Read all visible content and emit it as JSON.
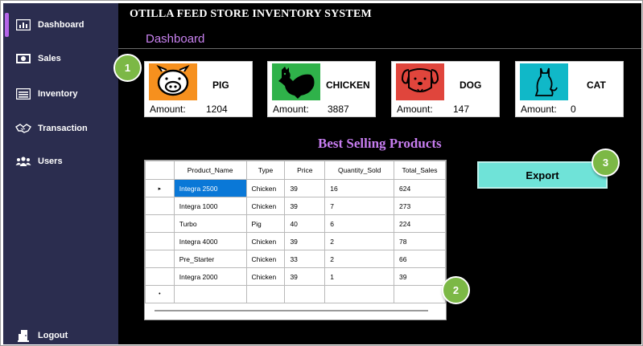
{
  "app_title": "OTILLA FEED STORE INVENTORY SYSTEM",
  "section_title": "Dashboard",
  "sidebar": {
    "items": [
      {
        "label": "Dashboard",
        "icon": "bar-chart-icon",
        "active": true
      },
      {
        "label": "Sales",
        "icon": "money-icon",
        "active": false
      },
      {
        "label": "Inventory",
        "icon": "inventory-box-icon",
        "active": false
      },
      {
        "label": "Transaction",
        "icon": "handshake-icon",
        "active": false
      },
      {
        "label": "Users",
        "icon": "users-icon",
        "active": false
      }
    ],
    "logout": {
      "label": "Logout",
      "icon": "door-icon"
    }
  },
  "cards": [
    {
      "name": "PIG",
      "amount_label": "Amount:",
      "amount": "1204",
      "icon": "pig-icon",
      "color": "#f6901e"
    },
    {
      "name": "CHICKEN",
      "amount_label": "Amount:",
      "amount": "3887",
      "icon": "chicken-icon",
      "color": "#2fb24a"
    },
    {
      "name": "DOG",
      "amount_label": "Amount:",
      "amount": "147",
      "icon": "dog-icon",
      "color": "#e0453c"
    },
    {
      "name": "CAT",
      "amount_label": "Amount:",
      "amount": "0",
      "icon": "cat-icon",
      "color": "#10b8c8"
    }
  ],
  "best_selling_title": "Best Selling Products",
  "table": {
    "columns": [
      "Product_Name",
      "Type",
      "Price",
      "Quantity_Sold",
      "Total_Sales"
    ],
    "rows": [
      [
        "Integra 2500",
        "Chicken",
        "39",
        "16",
        "624"
      ],
      [
        "Integra 1000",
        "Chicken",
        "39",
        "7",
        "273"
      ],
      [
        "Turbo",
        "Pig",
        "40",
        "6",
        "224"
      ],
      [
        "Integra 4000",
        "Chicken",
        "39",
        "2",
        "78"
      ],
      [
        "Pre_Starter",
        "Chicken",
        "33",
        "2",
        "66"
      ],
      [
        "Integra 2000",
        "Chicken",
        "39",
        "1",
        "39"
      ]
    ],
    "current_row_marker": "▸",
    "new_row_marker": "•"
  },
  "export_label": "Export",
  "badges": [
    "1",
    "2",
    "3"
  ],
  "colors": {
    "sidebar_bg": "#2b2d4f",
    "main_bg": "#000000",
    "accent_purple": "#c982f0",
    "export_bg": "#6fe3d8",
    "badge_green": "#7cb846",
    "selection_blue": "#0a78d7"
  }
}
